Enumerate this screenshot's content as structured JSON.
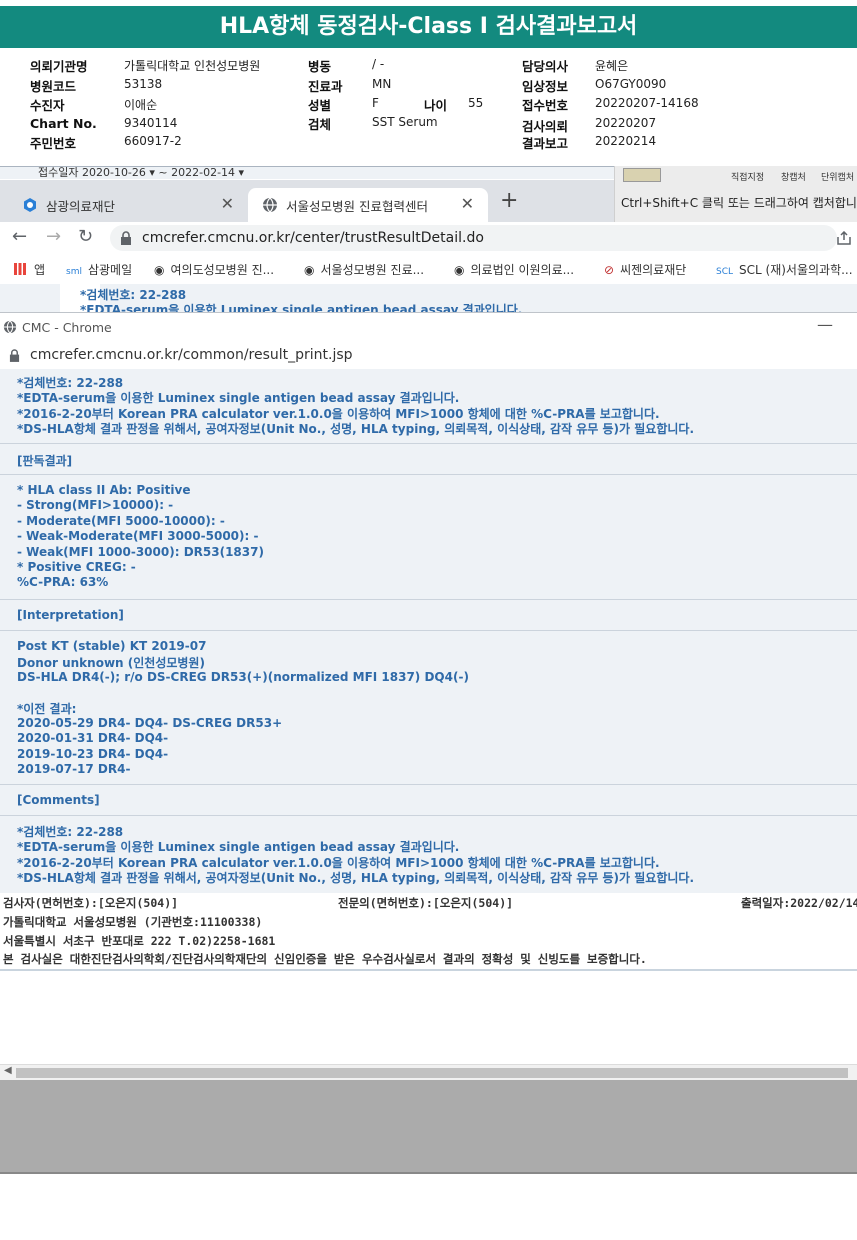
{
  "report": {
    "title": "HLA항체 동정검사-Class I 검사결과보고서",
    "labels": {
      "institution": "의뢰기관명",
      "hospital_code": "병원코드",
      "collector": "수진자",
      "chart_no": "Chart No.",
      "resident_no": "주민번호",
      "ward": "병동",
      "department": "진료과",
      "sex": "성별",
      "age": "나이",
      "specimen": "검체",
      "doctor": "담당의사",
      "clinical_info": "임상정보",
      "receipt_no": "접수번호",
      "request_date": "검사의뢰",
      "report_date": "결과보고"
    },
    "values": {
      "institution": "가톨릭대학교 인천성모병원",
      "hospital_code": "53138",
      "collector": "이애순",
      "chart_no": "9340114",
      "resident_no": "660917-2",
      "ward": "/ -",
      "department": "MN",
      "sex": "F",
      "age": "55",
      "specimen": "SST Serum",
      "doctor": "윤혜은",
      "clinical_info": "O67GY0090",
      "receipt_no": "20220207-14168",
      "request_date": "20220207",
      "report_date": "20220214"
    }
  },
  "partial_strip": "접수일자 2020-10-26 ▾ ~ 2022-02-14 ▾",
  "snip": {
    "hint": "Ctrl+Shift+C 클릭 또는 드래그하여 캡처합니다",
    "tiny": [
      "직접지정",
      "창캡처",
      "단위캡처"
    ]
  },
  "browser": {
    "tabs": [
      {
        "label": "삼광의료재단",
        "close": "✕"
      },
      {
        "label": "서울성모병원 진료협력센터",
        "close": "✕"
      }
    ],
    "new_tab": "+",
    "url": "cmcrefer.cmcnu.or.kr/center/trustResultDetail.do",
    "nav": {
      "back": "←",
      "forward": "→",
      "reload": "↻"
    },
    "bookmarks": [
      "앱",
      "삼광메일",
      "여의도성모병원 진...",
      "서울성모병원 진료...",
      "의료법인 이원의료...",
      "씨젠의료재단",
      "SCL (재)서울의과학..."
    ],
    "bg_lines": [
      "*검체번호: 22-288",
      "*EDTA-serum을 이용한 Luminex single antigen bead assay 결과입니다."
    ]
  },
  "popup": {
    "title": "CMC - Chrome",
    "min": "—",
    "url": "cmcrefer.cmcnu.or.kr/common/result_print.jsp"
  },
  "body": {
    "notes": [
      "*검체번호: 22-288",
      "*EDTA-serum을 이용한 Luminex single antigen bead assay 결과입니다.",
      "*2016-2-20부터 Korean PRA calculator ver.1.0.0을 이용하여 MFI>1000 항체에 대한 %C-PRA를 보고합니다.",
      "*DS-HLA항체 결과 판정을 위해서, 공여자정보(Unit No., 성명, HLA typing, 의뢰목적, 이식상태, 감작 유무 등)가 필요합니다."
    ],
    "result_header": "[판독결과]",
    "results": [
      "* HLA class II Ab: Positive",
      "- Strong(MFI>10000): -",
      "- Moderate(MFI 5000-10000): -",
      "- Weak-Moderate(MFI 3000-5000): -",
      "- Weak(MFI 1000-3000): DR53(1837)",
      "* Positive CREG: -",
      " %C-PRA: 63%"
    ],
    "interp_header": "[Interpretation]",
    "interp": [
      "Post KT (stable) KT 2019-07",
      "Donor unknown (인천성모병원)",
      "DS-HLA DR4(-); r/o DS-CREG DR53(+)(normalized MFI 1837) DQ4(-)"
    ],
    "prev_header": "*이전 결과:",
    "prev": [
      "2020-05-29 DR4- DQ4- DS-CREG DR53+",
      "2020-01-31 DR4- DQ4-",
      "2019-10-23 DR4- DQ4-",
      "2019-07-17 DR4-"
    ],
    "comments_header": "[Comments]",
    "comments": [
      "*검체번호: 22-288",
      "*EDTA-serum을 이용한 Luminex single antigen bead assay 결과입니다.",
      "*2016-2-20부터 Korean PRA calculator ver.1.0.0을 이용하여 MFI>1000 항체에 대한 %C-PRA를 보고합니다.",
      "*DS-HLA항체 결과 판정을 위해서, 공여자정보(Unit No., 성명, HLA typing, 의뢰목적, 이식상태, 감작 유무 등)가 필요합니다."
    ]
  },
  "footer": {
    "tester": "검사자(면허번호):[오은지(504)]",
    "specialist": "전문의(면허번호):[오은지(504)]",
    "print_date": "출력일자:2022/02/14",
    "hospital": "가톨릭대학교 서울성모병원 (기관번호:11100338)",
    "address": "서울특별시 서초구 반포대로 222 T.02)2258-1681",
    "certification": "본 검사실은 대한진단검사의학회/진단검사의학재단의 신임인증을 받은 우수검사실로서 결과의 정확성 및 신빙도를 보증합니다."
  },
  "colors": {
    "header_teal": "#138a7f",
    "report_blue": "#2f6aa8",
    "body_bg": "#eef2f6"
  }
}
